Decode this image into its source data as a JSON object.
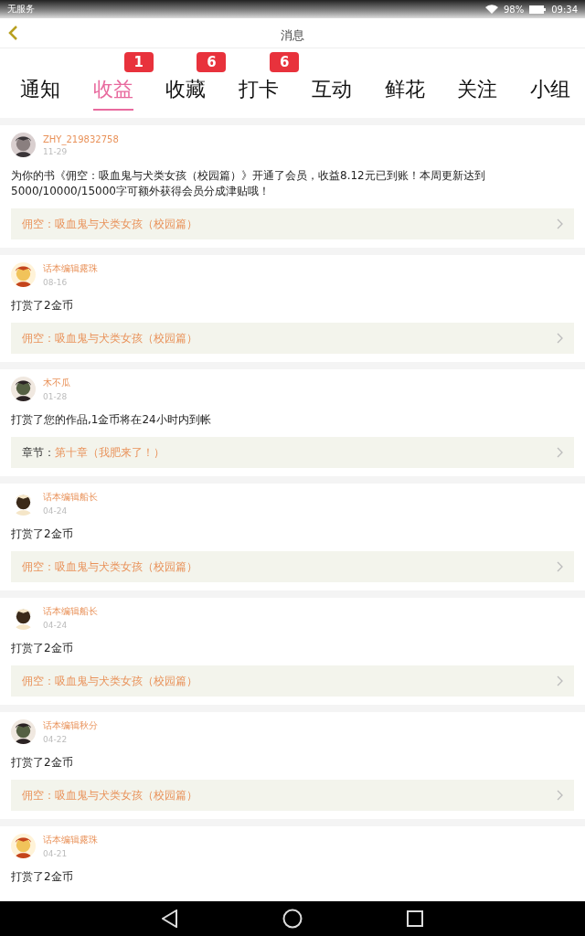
{
  "status_bar": {
    "carrier": "无服务",
    "battery": "98%",
    "time": "09:34"
  },
  "header": {
    "title": "消息"
  },
  "tabs": [
    {
      "label": "通知",
      "selected": false
    },
    {
      "label": "收益",
      "selected": true,
      "badge": "1"
    },
    {
      "label": "收藏",
      "selected": false,
      "badge": "6"
    },
    {
      "label": "打卡",
      "selected": false,
      "badge": "6"
    },
    {
      "label": "互动",
      "selected": false
    },
    {
      "label": "鲜花",
      "selected": false
    },
    {
      "label": "关注",
      "selected": false
    },
    {
      "label": "小组",
      "selected": false
    }
  ],
  "messages": [
    {
      "user": "ZHY_219832758",
      "date": "11-29",
      "text": "为你的书《佣空：吸血鬼与犬类女孩（校园篇）》开通了会员，收益8.12元已到账！本周更新达到5000/10000/15000字可额外获得会员分成津贴哦！",
      "link": {
        "text": "佣空：吸血鬼与犬类女孩（校园篇）"
      }
    },
    {
      "user": "话本编辑露珠",
      "date": "08-16",
      "text": "打赏了2金币",
      "link": {
        "text": "佣空：吸血鬼与犬类女孩（校园篇）"
      }
    },
    {
      "user": "木不瓜",
      "date": "01-28",
      "text": "打赏了您的作品,1金币将在24小时内到帐",
      "link": {
        "label": "章节：",
        "text": "第十章（我肥来了！）"
      }
    },
    {
      "user": "话本编辑船长",
      "date": "04-24",
      "text": "打赏了2金币",
      "link": {
        "text": "佣空：吸血鬼与犬类女孩（校园篇）"
      }
    },
    {
      "user": "话本编辑船长",
      "date": "04-24",
      "text": "打赏了2金币",
      "link": {
        "text": "佣空：吸血鬼与犬类女孩（校园篇）"
      }
    },
    {
      "user": "话本编辑秋分",
      "date": "04-22",
      "text": "打赏了2金币",
      "link": {
        "text": "佣空：吸血鬼与犬类女孩（校园篇）"
      }
    },
    {
      "user": "话本编辑露珠",
      "date": "04-21",
      "text": "打赏了2金币"
    }
  ]
}
